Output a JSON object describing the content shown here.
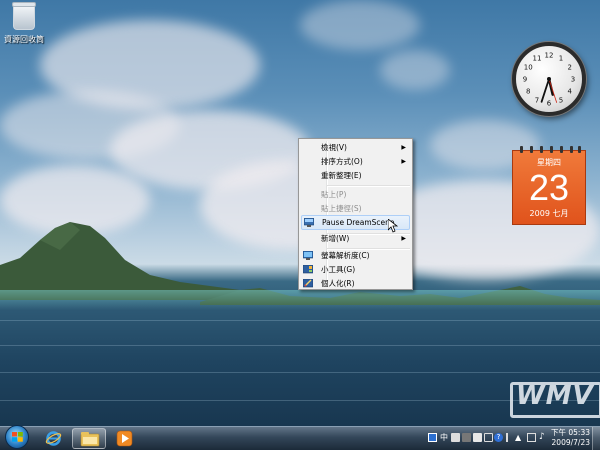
{
  "desktop": {
    "recycle_bin_label": "資源回收筒",
    "watermark": "WMV"
  },
  "clock_gadget": {
    "hour": 5,
    "minute": 33,
    "second": 27
  },
  "calendar_gadget": {
    "weekday": "星期四",
    "day": "23",
    "year_month": "2009 七月"
  },
  "context_menu": {
    "items": [
      {
        "label": "檢視(V)",
        "submenu": true,
        "disabled": false
      },
      {
        "label": "排序方式(O)",
        "submenu": true,
        "disabled": false
      },
      {
        "label": "重新整理(E)",
        "submenu": false,
        "disabled": false
      },
      {
        "label": "貼上(P)",
        "submenu": false,
        "disabled": true
      },
      {
        "label": "貼上捷徑(S)",
        "submenu": false,
        "disabled": true
      },
      {
        "label": "Pause DreamScene",
        "submenu": false,
        "disabled": false,
        "highlighted": true,
        "icon": "dreamscene-icon"
      },
      {
        "label": "新增(W)",
        "submenu": true,
        "disabled": false
      },
      {
        "label": "螢幕解析度(C)",
        "submenu": false,
        "disabled": false,
        "icon": "display-icon"
      },
      {
        "label": "小工具(G)",
        "submenu": false,
        "disabled": false,
        "icon": "gadgets-icon"
      },
      {
        "label": "個人化(R)",
        "submenu": false,
        "disabled": false,
        "icon": "personalize-icon"
      }
    ]
  },
  "taskbar": {
    "pinned": [
      "ie-icon",
      "explorer-folder-icon",
      "media-player-icon"
    ],
    "tray": {
      "lang_indicator": "中",
      "time": "下午 05:33",
      "date": "2009/7/23"
    }
  },
  "colors": {
    "calendar_orange": "#e0531c",
    "menu_highlight": "#d9e8f8"
  }
}
